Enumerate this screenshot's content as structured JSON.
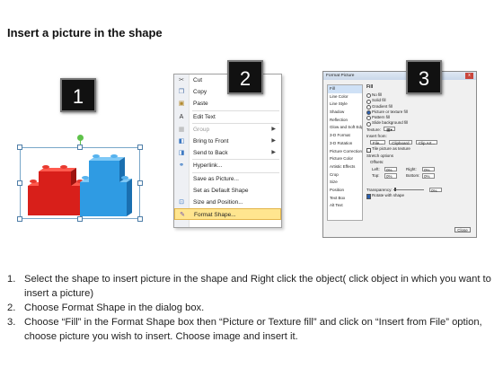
{
  "title": "Insert a picture in the shape",
  "badges": [
    "1",
    "2",
    "3"
  ],
  "colors": {
    "red_blocks": "#d81f1a",
    "blue_blocks": "#2f9be3",
    "selection": "#7aa7c9",
    "menu_highlight": "#ffe58f"
  },
  "context_menu": {
    "items": [
      {
        "icon": "scissors-icon",
        "label": "Cut",
        "enabled": true,
        "submenu": false
      },
      {
        "icon": "copy-icon",
        "label": "Copy",
        "enabled": true,
        "submenu": false
      },
      {
        "icon": "paste-icon",
        "label": "Paste",
        "enabled": true,
        "submenu": false
      },
      {
        "icon": "edit-text-icon",
        "label": "Edit Text",
        "enabled": true,
        "submenu": false
      },
      {
        "icon": "group-icon",
        "label": "Group",
        "enabled": false,
        "submenu": true
      },
      {
        "icon": "bring-front-icon",
        "label": "Bring to Front",
        "enabled": true,
        "submenu": true
      },
      {
        "icon": "send-back-icon",
        "label": "Send to Back",
        "enabled": true,
        "submenu": true
      },
      {
        "icon": "hyperlink-icon",
        "label": "Hyperlink...",
        "enabled": true,
        "submenu": false
      },
      {
        "icon": "",
        "label": "Save as Picture...",
        "enabled": true,
        "submenu": false
      },
      {
        "icon": "",
        "label": "Set as Default Shape",
        "enabled": true,
        "submenu": false
      },
      {
        "icon": "size-position-icon",
        "label": "Size and Position...",
        "enabled": true,
        "submenu": false
      },
      {
        "icon": "format-shape-icon",
        "label": "Format Shape...",
        "enabled": true,
        "submenu": false,
        "highlighted": true
      }
    ]
  },
  "dialog": {
    "title": "Format Picture",
    "close": "x",
    "nav": [
      "Fill",
      "Line Color",
      "Line Style",
      "Shadow",
      "Reflection",
      "Glow and Soft Edges",
      "3-D Format",
      "3-D Rotation",
      "Picture Corrections",
      "Picture Color",
      "Artistic Effects",
      "Crop",
      "Size",
      "Position",
      "Text Box",
      "Alt Text"
    ],
    "nav_selected": "Fill",
    "section": "Fill",
    "fill_options": [
      {
        "label": "No fill",
        "on": false
      },
      {
        "label": "Solid fill",
        "on": false
      },
      {
        "label": "Gradient fill",
        "on": false
      },
      {
        "label": "Picture or texture fill",
        "on": true
      },
      {
        "label": "Pattern fill",
        "on": false
      },
      {
        "label": "Slide background fill",
        "on": false
      }
    ],
    "texture_label": "Texture:",
    "insert_from_label": "Insert from:",
    "insert_buttons": [
      "File...",
      "Clipboard",
      "Clip Art..."
    ],
    "tile_label": "Tile picture as texture",
    "stretch_label": "Stretch options",
    "offsets_label": "Offsets:",
    "offsets": [
      {
        "label": "Left:",
        "value": "0%"
      },
      {
        "label": "Right:",
        "value": "0%"
      },
      {
        "label": "Top:",
        "value": "0%"
      },
      {
        "label": "Bottom:",
        "value": "0%"
      }
    ],
    "transparency_label": "Transparency:",
    "transparency_value": "0%",
    "rotate_label": "Rotate with shape",
    "close_button": "Close"
  },
  "instructions": [
    {
      "num": "1.",
      "text": "Select the shape to insert picture in the shape and Right click the object( click object in which you want to insert a picture)"
    },
    {
      "num": "2.",
      "text": "Choose Format Shape in the dialog box."
    },
    {
      "num": "3.",
      "text": "Choose “Fill” in the Format Shape box then “Picture or Texture fill”  and click on “Insert from File” option, choose picture you wish to insert. Choose image and insert it."
    }
  ]
}
